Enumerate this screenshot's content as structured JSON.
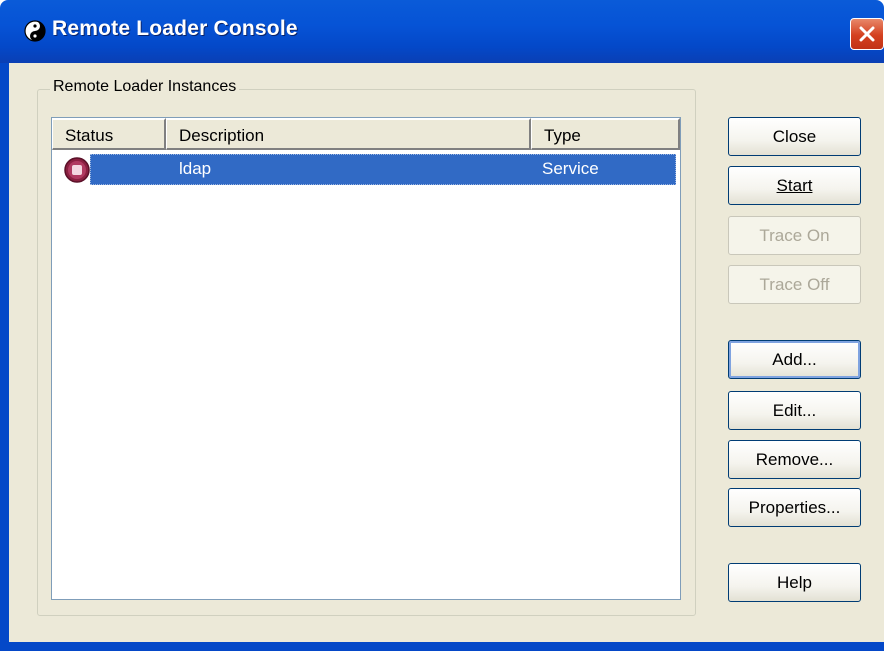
{
  "window": {
    "title": "Remote Loader Console",
    "title_icon": "yin-yang-icon",
    "close_icon": "close-icon"
  },
  "group": {
    "label": "Remote Loader Instances"
  },
  "list": {
    "columns": [
      "Status",
      "Description",
      "Type"
    ],
    "rows": [
      {
        "status_icon": "stopped-status-icon",
        "description": "ldap",
        "type": "Service",
        "selected": true
      }
    ]
  },
  "buttons": {
    "close": "Close",
    "start": "Start",
    "trace_on": "Trace On",
    "trace_off": "Trace Off",
    "add": "Add...",
    "edit": "Edit...",
    "remove": "Remove...",
    "properties": "Properties...",
    "help": "Help"
  },
  "colors": {
    "titlebar": "#0653d6",
    "selection": "#316ac5",
    "dialog_bg": "#ece9d8",
    "close_button": "#d4401f"
  }
}
